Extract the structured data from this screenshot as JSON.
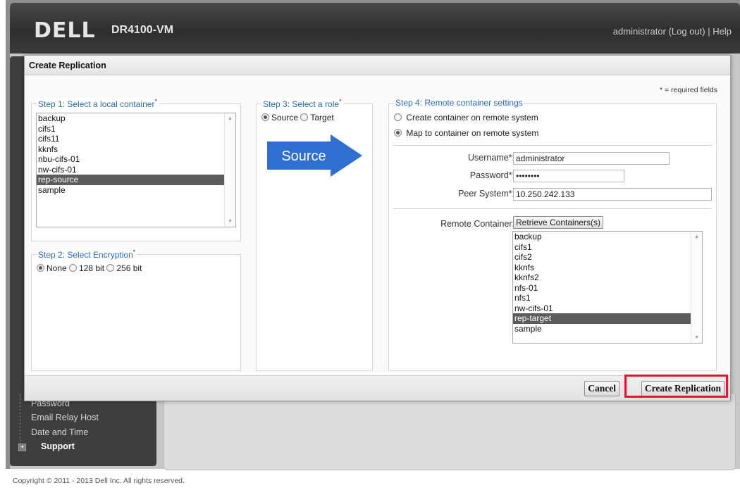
{
  "app": {
    "logo": "DELL",
    "product": "DR4100-VM",
    "user": "administrator",
    "logout": "(Log out)",
    "separator": "|",
    "help": "Help"
  },
  "sidebar": {
    "items": [
      {
        "label": "Password"
      },
      {
        "label": "Email Relay Host"
      },
      {
        "label": "Date and Time"
      },
      {
        "label": "Support"
      }
    ]
  },
  "copyright": "Copyright © 2011 - 2013 Dell Inc. All rights reserved.",
  "dialog": {
    "title": "Create Replication",
    "required_note": "* = required fields",
    "step1": {
      "legend": "Step 1: Select a local container",
      "asterisk": "*",
      "items": [
        "backup",
        "cifs1",
        "cifs11",
        "kknfs",
        "nbu-cifs-01",
        "nw-cifs-01",
        "rep-source",
        "sample"
      ],
      "selected": "rep-source"
    },
    "step2": {
      "legend": "Step 2: Select Encryption",
      "asterisk": "*",
      "options": [
        "None",
        "128 bit",
        "256 bit"
      ],
      "selected": "None"
    },
    "step3": {
      "legend": "Step 3: Select a role",
      "asterisk": "*",
      "options": [
        "Source",
        "Target"
      ],
      "selected": "Source",
      "arrow_label": "Source",
      "arrow_color": "#2f6fd0"
    },
    "step4": {
      "legend": "Step 4: Remote container settings",
      "options": [
        "Create container on remote system",
        "Map to container on remote system"
      ],
      "selected": "Map to container on remote system",
      "username_label": "Username",
      "username_value": "administrator",
      "password_label": "Password",
      "password_value": "********",
      "peer_label": "Peer System",
      "peer_value": "10.250.242.133",
      "req_mark": "*:",
      "remote_label": "Remote Container:",
      "retrieve_button": "Retrieve Containers(s)",
      "remote_items": [
        "backup",
        "cifs1",
        "cifs2",
        "kknfs",
        "kknfs2",
        "nfs-01",
        "nfs1",
        "nw-cifs-01",
        "rep-target",
        "sample"
      ],
      "remote_selected": "rep-target"
    },
    "footer": {
      "cancel": "Cancel",
      "create": "Create Replication",
      "highlight_color": "#d81e2a"
    }
  }
}
